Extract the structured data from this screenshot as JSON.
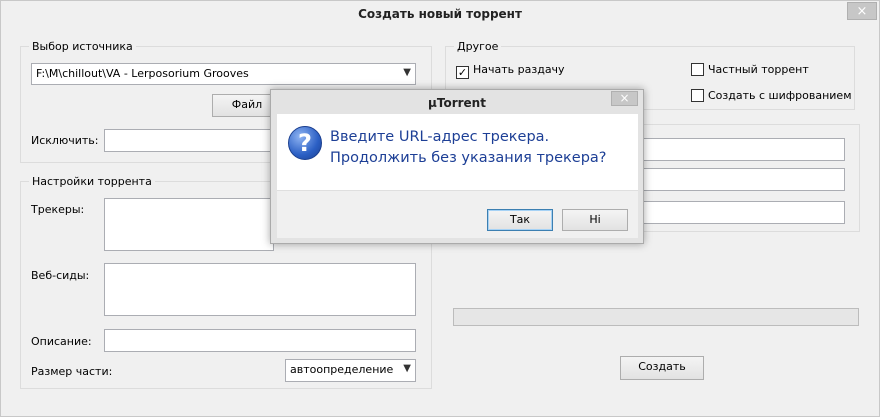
{
  "window": {
    "title": "Создать новый торрент",
    "close_glyph": "×"
  },
  "source": {
    "legend": "Выбор источника",
    "path": "F:\\M\\chillout\\VA - Lerposorium Grooves",
    "file_button": "Файл",
    "exclude_label": "Исключить:",
    "exclude_value": ""
  },
  "settings": {
    "legend": "Настройки торрента",
    "trackers_label": "Трекеры:",
    "trackers_value": "",
    "webseeds_label": "Веб-сиды:",
    "webseeds_value": "",
    "description_label": "Описание:",
    "description_value": "",
    "piece_size_label": "Размер части:",
    "piece_size_value": "автоопределение"
  },
  "other": {
    "legend": "Другое",
    "start_seeding": {
      "label": "Начать раздачу",
      "checked": true
    },
    "private_torrent": {
      "label": "Частный торрент",
      "checked": false
    },
    "encryption": {
      "label": "Создать с шифрованием",
      "checked": false
    }
  },
  "progress": {
    "value": 0
  },
  "create_button": "Создать",
  "dialog": {
    "title": "µTorrent",
    "close_glyph": "×",
    "icon": "question-icon",
    "icon_glyph": "?",
    "message": "Введите URL-адрес трекера. Продолжить без указания трекера?",
    "yes_button": "Так",
    "no_button": "Ні"
  },
  "colors": {
    "dialog_text": "#1d3f96",
    "window_bg": "#f0f0f0"
  }
}
